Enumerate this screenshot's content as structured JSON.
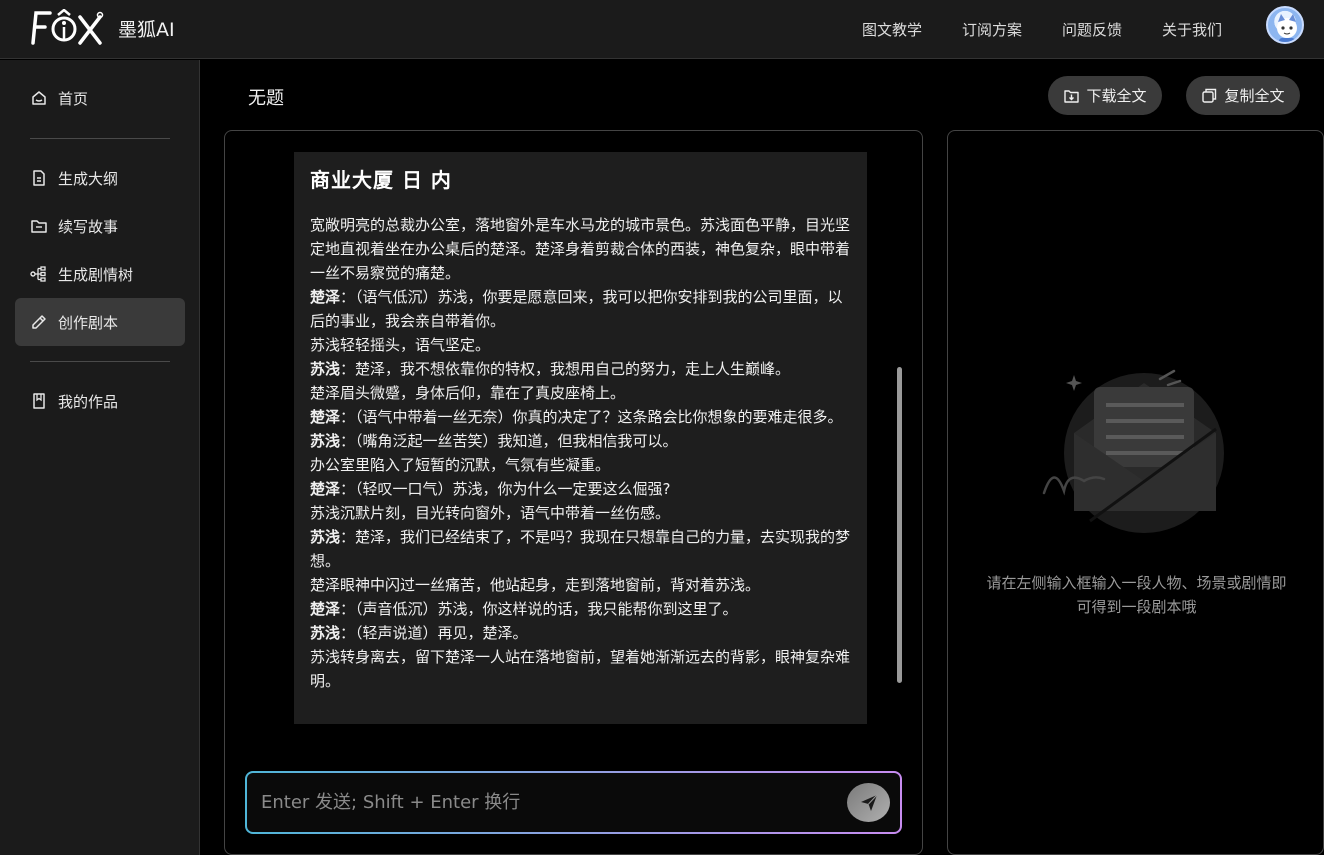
{
  "app": {
    "brand": "墨狐AI",
    "logo_text": "FOX"
  },
  "nav": {
    "items": [
      "图文教学",
      "订阅方案",
      "问题反馈",
      "关于我们"
    ]
  },
  "sidebar": {
    "items": [
      {
        "label": "首页",
        "icon": "home-icon"
      },
      {
        "label": "生成大纲",
        "icon": "document-icon"
      },
      {
        "label": "续写故事",
        "icon": "folder-icon"
      },
      {
        "label": "生成剧情树",
        "icon": "tree-icon"
      },
      {
        "label": "创作剧本",
        "icon": "pencil-icon",
        "active": true
      },
      {
        "label": "我的作品",
        "icon": "bookmark-icon"
      }
    ]
  },
  "header": {
    "title": "无题",
    "download_label": "下载全文",
    "copy_label": "复制全文"
  },
  "script": {
    "heading": "商业大厦 日 内",
    "lines": [
      {
        "speaker": "",
        "text": "宽敞明亮的总裁办公室，落地窗外是车水马龙的城市景色。苏浅面色平静，目光坚定地直视着坐在办公桌后的楚泽。楚泽身着剪裁合体的西装，神色复杂，眼中带着一丝不易察觉的痛楚。"
      },
      {
        "speaker": "楚泽",
        "text": "：（语气低沉）苏浅，你要是愿意回来，我可以把你安排到我的公司里面，以后的事业，我会亲自带着你。"
      },
      {
        "speaker": "",
        "text": "苏浅轻轻摇头，语气坚定。"
      },
      {
        "speaker": "苏浅",
        "text": "：楚泽，我不想依靠你的特权，我想用自己的努力，走上人生巅峰。"
      },
      {
        "speaker": "",
        "text": "楚泽眉头微蹙，身体后仰，靠在了真皮座椅上。"
      },
      {
        "speaker": "楚泽",
        "text": "：（语气中带着一丝无奈）你真的决定了？这条路会比你想象的要难走很多。"
      },
      {
        "speaker": "苏浅",
        "text": "：（嘴角泛起一丝苦笑）我知道，但我相信我可以。"
      },
      {
        "speaker": "",
        "text": "办公室里陷入了短暂的沉默，气氛有些凝重。"
      },
      {
        "speaker": "楚泽",
        "text": "：（轻叹一口气）苏浅，你为什么一定要这么倔强?"
      },
      {
        "speaker": "",
        "text": "苏浅沉默片刻，目光转向窗外，语气中带着一丝伤感。"
      },
      {
        "speaker": "苏浅",
        "text": "：楚泽，我们已经结束了，不是吗？我现在只想靠自己的力量，去实现我的梦想。"
      },
      {
        "speaker": "",
        "text": "楚泽眼神中闪过一丝痛苦，他站起身，走到落地窗前，背对着苏浅。"
      },
      {
        "speaker": "楚泽",
        "text": "：（声音低沉）苏浅，你这样说的话，我只能帮你到这里了。"
      },
      {
        "speaker": "苏浅",
        "text": "：（轻声说道）再见，楚泽。"
      },
      {
        "speaker": "",
        "text": "苏浅转身离去，留下楚泽一人站在落地窗前，望着她渐渐远去的背影，眼神复杂难明。"
      }
    ]
  },
  "input": {
    "placeholder": "Enter 发送; Shift + Enter 换行",
    "value": ""
  },
  "right_panel": {
    "empty_hint": "请在左侧输入框输入一段人物、场景或剧情即可得到一段剧本哦"
  },
  "colors": {
    "topbar_bg": "#1b1b1b",
    "sidebar_active": "#3a3a3a",
    "input_border_gradient": [
      "#4fb6d8",
      "#c78cf0"
    ]
  }
}
